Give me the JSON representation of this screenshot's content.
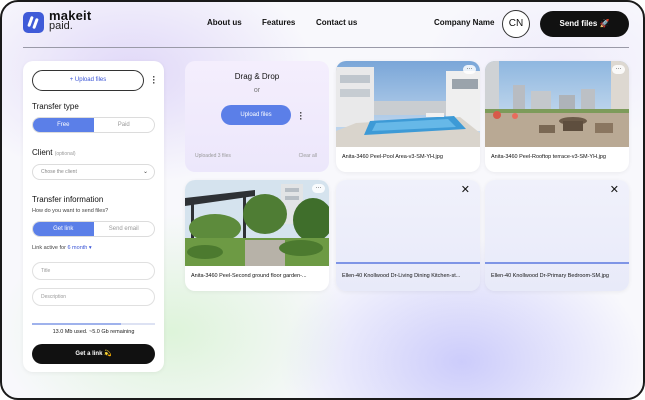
{
  "header": {
    "logo_line1": "makeit",
    "logo_line2": "paid.",
    "nav": [
      "About us",
      "Features",
      "Contact us"
    ],
    "company_name": "Company Name",
    "avatar_initials": "CN",
    "send_button": "Send files 🚀"
  },
  "sidebar": {
    "upload_files": "+ Upload files",
    "transfer_type_title": "Transfer type",
    "transfer_type_options": [
      "Free",
      "Paid"
    ],
    "transfer_type_selected": "Free",
    "client_title": "Client",
    "client_optional": "(optional)",
    "client_placeholder": "Chose the client",
    "transfer_info_title": "Transfer information",
    "transfer_question": "How do you want to send files?",
    "send_methods": [
      "Get link",
      "Send email"
    ],
    "send_method_selected": "Get link",
    "link_active_prefix": "Link active for",
    "link_active_value": "6 month ▾",
    "title_placeholder": "Title",
    "description_placeholder": "Description",
    "storage_used_fraction": 0.72,
    "usage_text": "13.0 Mb used. ~5.0 Gb remaining",
    "get_link_button": "Get a link 💫"
  },
  "dropzone": {
    "title": "Drag & Drop",
    "or": "or",
    "upload_button": "Upload files",
    "uploaded_count": "Uploaded 3 files",
    "clear_all": "Clear all"
  },
  "files": [
    {
      "name": "Anita-3460 Peel-Pool Area-v3-SM-YH.jpg",
      "kind": "photo-pool",
      "action": "more"
    },
    {
      "name": "Anita-3460 Peel-Rooftop terrace-v3-SM-YH.jpg",
      "kind": "photo-rooftop",
      "action": "more"
    },
    {
      "name": "Anita-3460 Peel-Second ground floor garden-...",
      "kind": "photo-garden",
      "action": "more"
    },
    {
      "name": "Ellen-40 Knollwood Dr-Living Dining Kitchen-st...",
      "kind": "uploading",
      "action": "close",
      "progress": 1.0
    },
    {
      "name": "Ellen-40 Knollwood Dr-Primary Bedroom-SM.jpg",
      "kind": "uploading",
      "action": "close",
      "progress": 1.0
    }
  ],
  "icons": {
    "more": "…",
    "close": "✕",
    "kebab": "⋮",
    "chevron": "⌄"
  },
  "colors": {
    "accent": "#5b7fe8",
    "brand": "#3f5bd8",
    "dark": "#111111"
  }
}
